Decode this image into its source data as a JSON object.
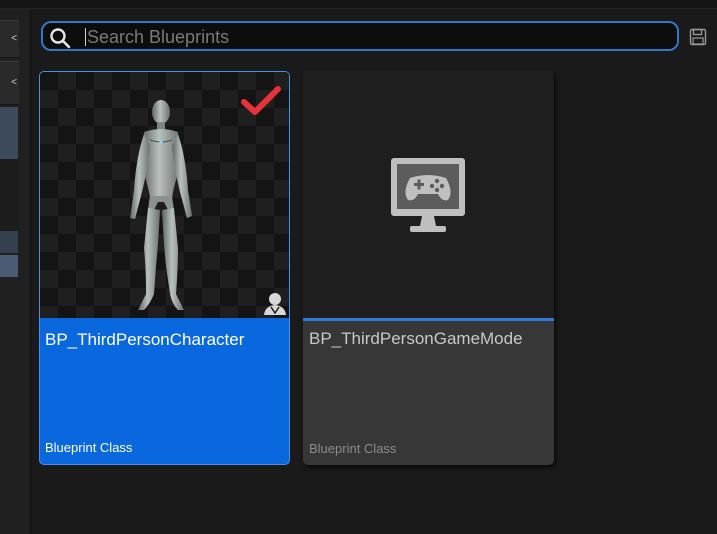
{
  "search": {
    "placeholder": "Search Blueprints",
    "value": ""
  },
  "toolbar": {
    "save_icon": "save-icon"
  },
  "left_panel": {
    "buttons": [
      "<",
      "<"
    ]
  },
  "assets": [
    {
      "name": "BP_ThirdPersonCharacter",
      "type": "Blueprint Class",
      "selected": true,
      "thumbnail": "character-mannequin",
      "badge_icon": "person-icon",
      "checkmark_icon": "checkmark-icon"
    },
    {
      "name": "BP_ThirdPersonGameMode",
      "type": "Blueprint Class",
      "selected": false,
      "thumbnail": "game-mode-icon"
    }
  ],
  "colors": {
    "selection": "#0a68df",
    "accent": "#2f79c9",
    "checkmark": "#e8323a"
  }
}
